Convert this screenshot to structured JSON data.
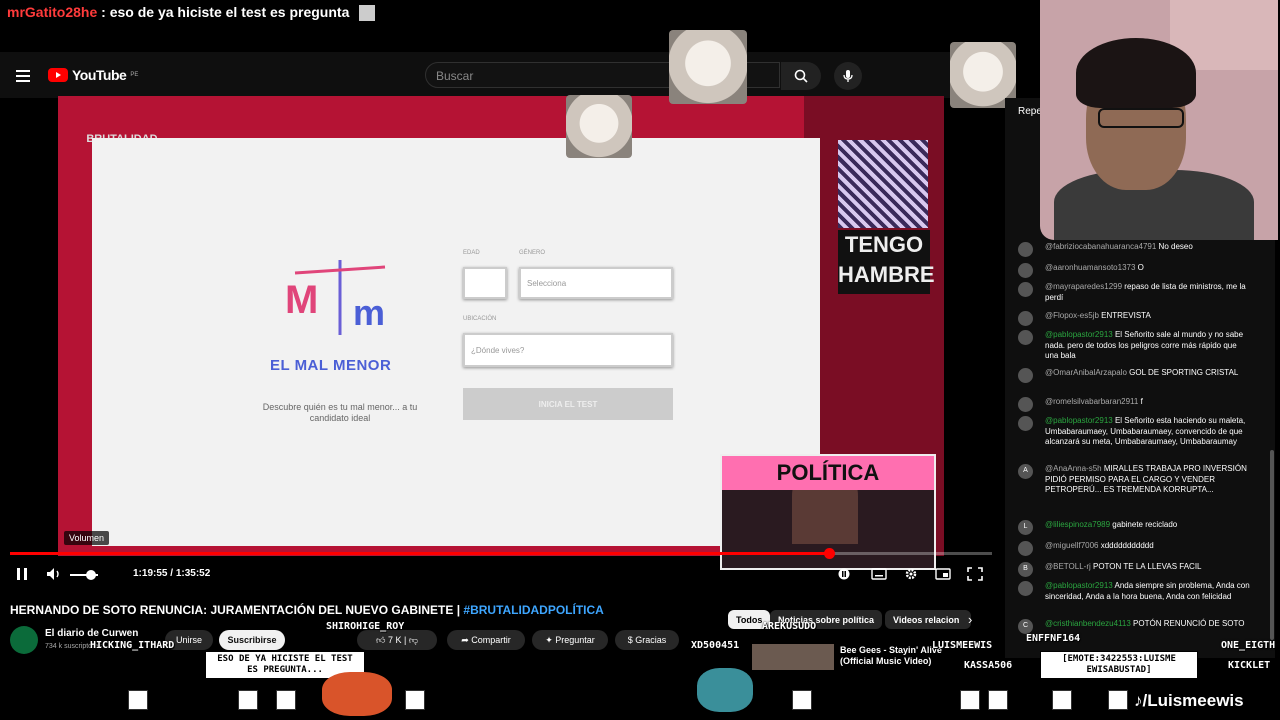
{
  "top_chat": {
    "user": "mrGatito28he",
    "separator": ":",
    "message": "eso de ya hiciste el test es pregunta"
  },
  "yt": {
    "logo_text": "YouTube",
    "country": "PE",
    "search_placeholder": "Buscar"
  },
  "video": {
    "brand_overlay": "BRUTALIDAD POLÍTICA",
    "site_logo_text": "EL MAL MENOR",
    "site_desc": "Descubre quién es tu mal menor... a tu candidato ideal",
    "field_edad": "EDAD",
    "field_genero": "GÉNERO",
    "genero_value": "Selecciona",
    "field_ubicacion": "UBICACIÓN",
    "ubicacion_value": "¿Dónde vives?",
    "start_button": "INICIA EL TEST",
    "side_text": "TENGO HAMBRE",
    "inset_banner": "POLÍTICA"
  },
  "player": {
    "volume_tooltip": "Volumen",
    "current_time": "1:19:55",
    "time_sep": "/",
    "duration": "1:35:52",
    "progress_fraction": 0.834
  },
  "meta": {
    "title": "HERNANDO DE SOTO RENUNCIA: JURAMENTACIÓN DEL NUEVO GABINETE |",
    "hashtag": "#BRUTALIDADPOLÍTICA",
    "channel": "El diario de Curwen",
    "subs": "734 k suscriptores",
    "join": "Unirse",
    "subscribe": "Suscribirse",
    "likes": "7 K",
    "share": "Compartir",
    "ask": "Preguntar",
    "thanks": "Gracias"
  },
  "chips": [
    "Todos",
    "Noticias sobre política",
    "Videos relacion"
  ],
  "recommended": {
    "title": "Bee Gees - Stayin' Alive (Official Music Video)"
  },
  "chat_header": "Repe",
  "chat": [
    {
      "user": "@fabriziocabanahuaranca4791",
      "msg": "No deseo",
      "av": ""
    },
    {
      "user": "@aaronhuamansoto1373",
      "msg": "O",
      "av": ""
    },
    {
      "user": "@mayraparedes1299",
      "msg": "repaso de lista de ministros, me la perdí",
      "av": ""
    },
    {
      "user": "@Flopox-es5jb",
      "msg": "ENTREVISTA",
      "av": ""
    },
    {
      "user": "@pablopastor2913",
      "msg": "El Señorito sale al mundo y no sabe nada. pero de todos los peligros corre más rápido que una bala",
      "av": ""
    },
    {
      "user": "@OmarAnibalArzapalo",
      "msg": "GOL DE SPORTING CRISTAL",
      "av": ""
    },
    {
      "user": "@romelsilvabarbaran2911",
      "msg": "f",
      "av": ""
    },
    {
      "user": "@pablopastor2913",
      "msg": "El Señorito esta haciendo su maleta, Umbabaraumaey, Umbabaraumaey, convencido de que alcanzará su meta, Umbabaraumaey, Umbabaraumay",
      "av": ""
    },
    {
      "user": "@AnaAnna-s5h",
      "msg": "MIRALLES TRABAJA PRO INVERSIÓN PIDIÓ PERMISO PARA EL CARGO Y VENDER PETROPERÚ... ES TREMENDA KORRUPTA...",
      "av": "A"
    },
    {
      "user": "@liliespinoza7989",
      "msg": "gabinete reciclado",
      "av": "L"
    },
    {
      "user": "@miguellf7006",
      "msg": "xddddddddddd",
      "av": ""
    },
    {
      "user": "@BETOLL-rj",
      "msg": "POTON TE LA LLEVAS FACIL",
      "av": "B"
    },
    {
      "user": "@pablopastor2913",
      "msg": "Anda siempre sin problema, Anda con sinceridad, Anda a la hora buena, Anda con felicidad",
      "av": ""
    },
    {
      "user": "@cristhianbendezu4113",
      "msg": "POTÓN RENUNCIÓ DE SOTO",
      "av": "C"
    }
  ],
  "overlay": {
    "names": [
      "HICKING_ITHARD",
      "SHIROHIGE_ROY",
      "AREKUSUDO",
      "XD500451",
      "LUISMEEWIS",
      "ENFFNF164",
      "KASSA506",
      "ONE_EIGTH",
      "KICKLET"
    ],
    "bubble1": "ESO DE YA HICISTE EL TEST ES PREGUNTA...",
    "bubble2": "[EMOTE:3422553:LUISME EWISABUSTAD]",
    "tiktok": "♪/Luismeewis"
  },
  "colors": {
    "yt_red": "#ff0000",
    "video_bg": "#b51334",
    "link": "#3ea6ff",
    "chat_green": "#2ba640"
  }
}
